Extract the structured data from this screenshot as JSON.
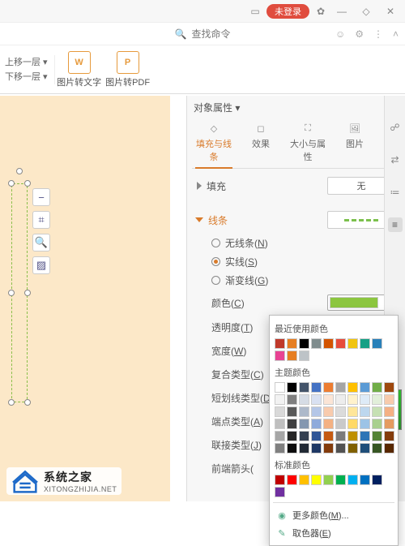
{
  "titlebar": {
    "login": "未登录"
  },
  "cmdbar": {
    "search_placeholder": "查找命令"
  },
  "ribbon": {
    "arrange_up": "上移一层",
    "arrange_down": "下移一层",
    "btn_img2text": "图片转文字",
    "btn_img2pdf": "图片转PDF"
  },
  "panel": {
    "title": "对象属性",
    "tabs": {
      "fill_line": "填充与线条",
      "effect": "效果",
      "size_prop": "大小与属性",
      "image": "图片"
    },
    "fill": {
      "label": "填充",
      "value": "无"
    },
    "line": {
      "label": "线条",
      "no_line": "无线条",
      "no_line_key": "N",
      "solid": "实线",
      "solid_key": "S",
      "gradient": "渐变线",
      "gradient_key": "G"
    },
    "props": {
      "color": "颜色",
      "color_key": "C",
      "opacity": "透明度",
      "opacity_key": "T",
      "width": "宽度",
      "width_key": "W",
      "compound": "复合类型",
      "compound_key": "C",
      "dash": "短划线类型",
      "dash_key": "D",
      "cap": "端点类型",
      "cap_key": "A",
      "join": "联接类型",
      "join_key": "J",
      "arrow_front": "前端箭头"
    }
  },
  "popover": {
    "recent_label": "最近使用颜色",
    "theme_label": "主题颜色",
    "standard_label": "标准颜色",
    "more_colors": "更多颜色",
    "more_colors_key": "M",
    "eyedropper": "取色器",
    "eyedropper_key": "E",
    "recent": [
      "#c0392b",
      "#e67e22",
      "#000000",
      "#7f8c8d",
      "#d35400",
      "#e74c3c",
      "#f1c40f",
      "#16a085",
      "#2980b9",
      "#e84393",
      "#e67e22",
      "#bdc3c7"
    ],
    "theme_head": [
      "#ffffff",
      "#000000",
      "#44546a",
      "#4472c4",
      "#ed7d31",
      "#a5a5a5",
      "#ffc000",
      "#5b9bd5",
      "#70ad47",
      "#9e480e"
    ],
    "theme_shades": [
      [
        "#f2f2f2",
        "#7f7f7f",
        "#d6dce5",
        "#d9e1f2",
        "#fbe5d6",
        "#ededed",
        "#fff2cc",
        "#deebf7",
        "#e2efda",
        "#f7cbac"
      ],
      [
        "#d9d9d9",
        "#595959",
        "#adb9ca",
        "#b4c6e7",
        "#f8cbad",
        "#dbdbdb",
        "#ffe699",
        "#bdd7ee",
        "#c6e0b4",
        "#f4b084"
      ],
      [
        "#bfbfbf",
        "#404040",
        "#8497b0",
        "#8eaadb",
        "#f4b183",
        "#c9c9c9",
        "#ffd966",
        "#9cc3e6",
        "#a9d08e",
        "#e59b61"
      ],
      [
        "#a6a6a6",
        "#262626",
        "#333f50",
        "#2f5597",
        "#c55a11",
        "#7b7b7b",
        "#bf9000",
        "#2e75b6",
        "#548235",
        "#843c0c"
      ],
      [
        "#808080",
        "#0d0d0d",
        "#222a35",
        "#1f3864",
        "#833c0c",
        "#525252",
        "#806000",
        "#1f4e79",
        "#375623",
        "#572700"
      ]
    ],
    "standard": [
      "#c00000",
      "#ff0000",
      "#ffc000",
      "#ffff00",
      "#92d050",
      "#00b050",
      "#00b0f0",
      "#0070c0",
      "#002060",
      "#7030a0"
    ]
  },
  "watermark": {
    "line1": "系统之家",
    "line2": "XITONGZHIJIA.NET"
  },
  "colors": {
    "accent": "#d97b2b",
    "line_green": "#8cc63f"
  }
}
